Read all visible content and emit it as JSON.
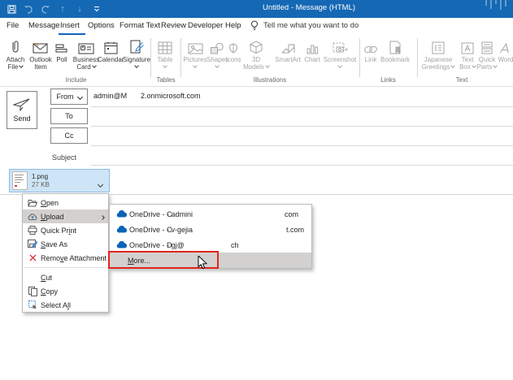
{
  "titlebar": {
    "title": "Untitled  -  Message (HTML)"
  },
  "menubar": {
    "tabs": [
      "File",
      "Message",
      "Insert",
      "Options",
      "Format Text",
      "Review",
      "Developer",
      "Help"
    ],
    "active_tab": "Insert",
    "tellme": "Tell me what you want to do"
  },
  "ribbon": {
    "groups": [
      {
        "label": "Include",
        "buttons": [
          {
            "l1": "Attach",
            "l2": "File"
          },
          {
            "l1": "Outlook",
            "l2": "Item"
          },
          {
            "l1": "Poll"
          },
          {
            "l1": "Business",
            "l2": "Card"
          },
          {
            "l1": "Calendar"
          },
          {
            "l1": "Signature"
          }
        ]
      },
      {
        "label": "Tables",
        "buttons": [
          {
            "l1": "Table"
          }
        ]
      },
      {
        "label": "Illustrations",
        "buttons": [
          {
            "l1": "Pictures"
          },
          {
            "l1": "Shapes"
          },
          {
            "l1": "Icons"
          },
          {
            "l1": "3D",
            "l2": "Models"
          },
          {
            "l1": "SmartArt"
          },
          {
            "l1": "Chart"
          },
          {
            "l1": "Screenshot"
          }
        ]
      },
      {
        "label": "Links",
        "buttons": [
          {
            "l1": "Link"
          },
          {
            "l1": "Bookmark"
          }
        ]
      },
      {
        "label": "Text",
        "buttons": [
          {
            "l1": "Japanese",
            "l2": "Greetings"
          },
          {
            "l1": "Text",
            "l2": "Box"
          },
          {
            "l1": "Quick",
            "l2": "Parts"
          },
          {
            "l1": "Word"
          }
        ]
      }
    ]
  },
  "compose": {
    "send_label": "Send",
    "from_label": "From",
    "from_user": "admin@M",
    "from_domain": "2.onmicrosoft.com",
    "to_label": "To",
    "cc_label": "Cc",
    "subject_label": "Subject"
  },
  "attachment": {
    "name": "1.png",
    "size": "27 KB"
  },
  "context_menu": {
    "items": [
      {
        "pre": "",
        "acc": "O",
        "post": "pen"
      },
      {
        "pre": "",
        "acc": "U",
        "post": "pload"
      },
      {
        "pre": "Quick Pr",
        "acc": "i",
        "post": "nt"
      },
      {
        "pre": "",
        "acc": "S",
        "post": "ave As"
      },
      {
        "pre": "Remo",
        "acc": "v",
        "post": "e Attachment"
      },
      {
        "pre": "",
        "acc": "C",
        "post": "ut"
      },
      {
        "pre": "",
        "acc": "C",
        "post": "opy"
      },
      {
        "pre": "Select A",
        "acc": "l",
        "post": "l"
      }
    ]
  },
  "upload_submenu": {
    "items": [
      {
        "name": "OneDrive - C",
        "account": "- admini",
        "suffix": "com"
      },
      {
        "name": "OneDrive - C",
        "account": "- v-gejia",
        "suffix": "t.com"
      },
      {
        "name": "OneDrive - D",
        "account": "- gj@",
        "suffix": "ch"
      }
    ],
    "more": {
      "acc": "M",
      "post": "ore..."
    }
  },
  "colors": {
    "titlebar_blue": "#1568b4",
    "tab_accent": "#1066b6",
    "onedrive_blue": "#0b64b6",
    "annotation_red": "#e1251b",
    "selection_blue": "#cde5f7"
  }
}
